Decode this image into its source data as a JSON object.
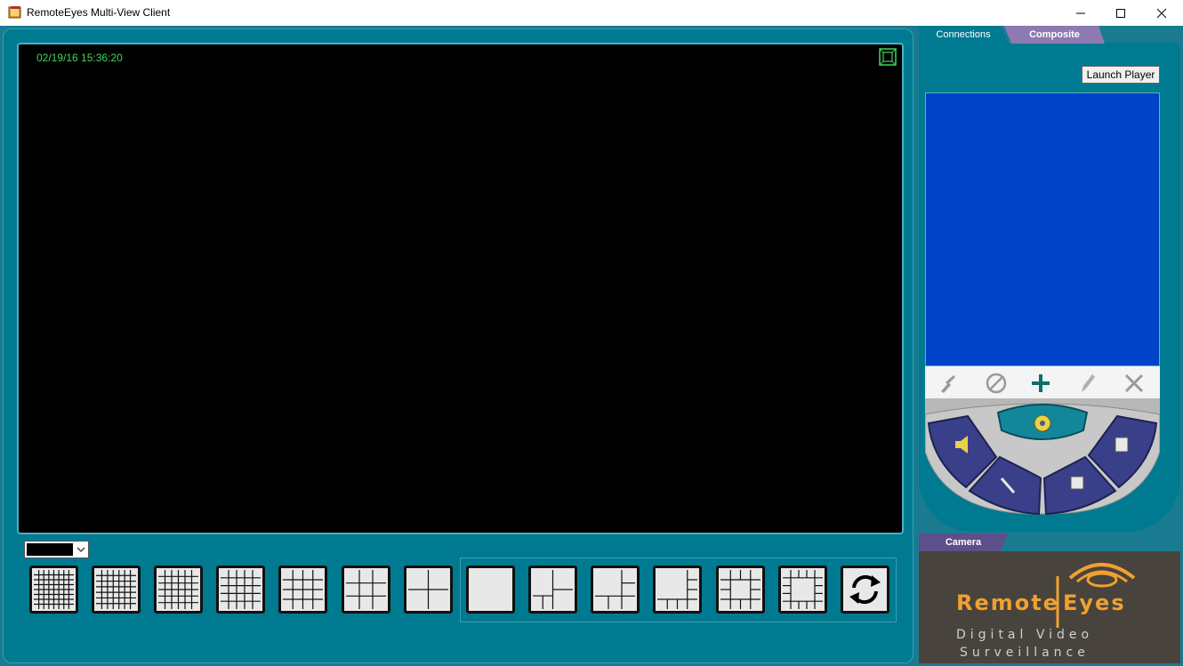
{
  "window": {
    "title": "RemoteEyes Multi-View Client"
  },
  "video": {
    "timestamp": "02/19/16 15:36:20"
  },
  "tabs": {
    "connections": "Connections",
    "composite": "Composite",
    "camera": "Camera"
  },
  "buttons": {
    "launch_player": "Launch Player"
  },
  "logo": {
    "word1": "Remote",
    "word2": "Eyes",
    "line1": "Digital Video",
    "line2": "Surveillance"
  },
  "colors": {
    "panel": "#007a91",
    "list": "#0042c8",
    "timestamp": "#41d65a",
    "logo_orange": "#f0a030"
  },
  "layouts": [
    {
      "name": "layout-grid-8x8"
    },
    {
      "name": "layout-grid-7x7"
    },
    {
      "name": "layout-grid-6x6"
    },
    {
      "name": "layout-grid-5x5"
    },
    {
      "name": "layout-grid-4x4"
    },
    {
      "name": "layout-grid-3x3"
    },
    {
      "name": "layout-grid-2x2"
    },
    {
      "name": "layout-single"
    },
    {
      "name": "layout-1-plus-3"
    },
    {
      "name": "layout-1-plus-5"
    },
    {
      "name": "layout-1-plus-7"
    },
    {
      "name": "layout-1-plus-8"
    },
    {
      "name": "layout-1-plus-12"
    }
  ],
  "toolbar_icons": [
    "connect-icon",
    "disconnect-icon",
    "add-icon",
    "edit-icon",
    "delete-icon"
  ]
}
